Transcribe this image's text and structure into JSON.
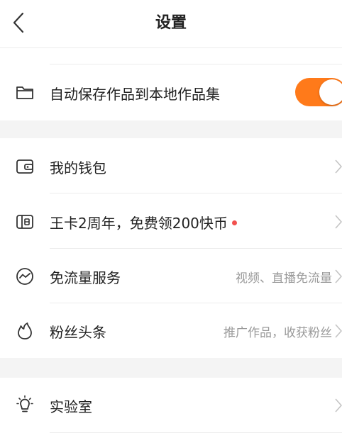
{
  "header": {
    "title": "设置"
  },
  "colors": {
    "accent": "#ff7a1a",
    "badge_dot": "#f2514e",
    "section_gap": "#f4f4f4",
    "secondary_text": "#9a9a9a"
  },
  "sections": [
    {
      "items": [
        {
          "icon": "folder-icon",
          "label": "自动保存作品到本地作品集",
          "control": "toggle",
          "toggle_on": true
        }
      ]
    },
    {
      "items": [
        {
          "icon": "wallet-icon",
          "label": "我的钱包",
          "value": ""
        },
        {
          "icon": "sim-card-icon",
          "label": "王卡2周年，免费领200快币",
          "badge_dot": true,
          "value": ""
        },
        {
          "icon": "traffic-icon",
          "label": "免流量服务",
          "value": "视频、直播免流量"
        },
        {
          "icon": "flame-icon",
          "label": "粉丝头条",
          "value": "推广作品，收获粉丝"
        }
      ]
    },
    {
      "items": [
        {
          "icon": "lightbulb-icon",
          "label": "实验室",
          "value": ""
        }
      ]
    }
  ]
}
